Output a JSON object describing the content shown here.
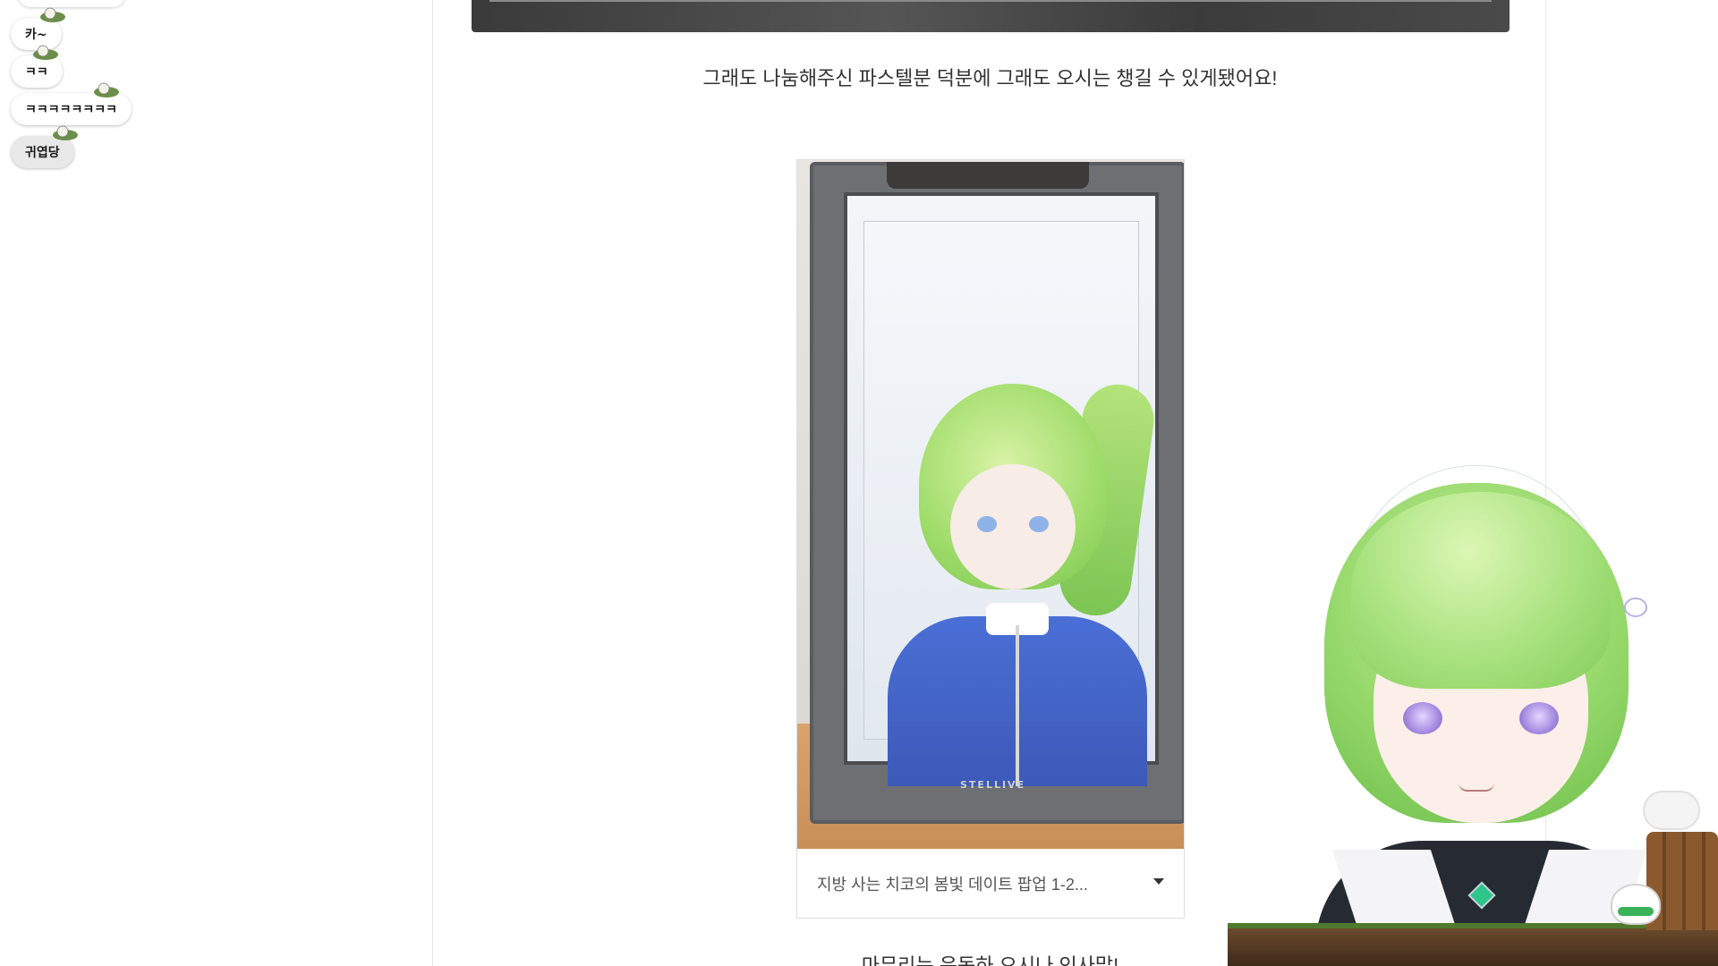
{
  "chat": {
    "messages": [
      {
        "text": "카~"
      },
      {
        "text": "ㅋㅋ"
      },
      {
        "text": "ㅋㅋㅋㅋㅋㅋㅋㅋ"
      },
      {
        "text": "귀엽당"
      }
    ]
  },
  "article": {
    "caption": "그래도 나눔해주신 파스텔분 덕분에 그래도 오시는 챙길 수 있게됐어요!",
    "video": {
      "title": "지방 사는 치코의 봄빛 데이트 팝업 1-2...",
      "cabinet_brand": "STELLIVE"
    },
    "bottom_text": "마무리는 운동하 오시나 인사말!"
  },
  "colors": {
    "page_bg": "#ffffff",
    "hair_green": "#95d86a",
    "outfit_dark": "#262b33",
    "accent_gem": "#2fc489"
  },
  "icons": {
    "dropdown": "chevron-down-icon",
    "sticker": "frog-sticker-icon"
  }
}
